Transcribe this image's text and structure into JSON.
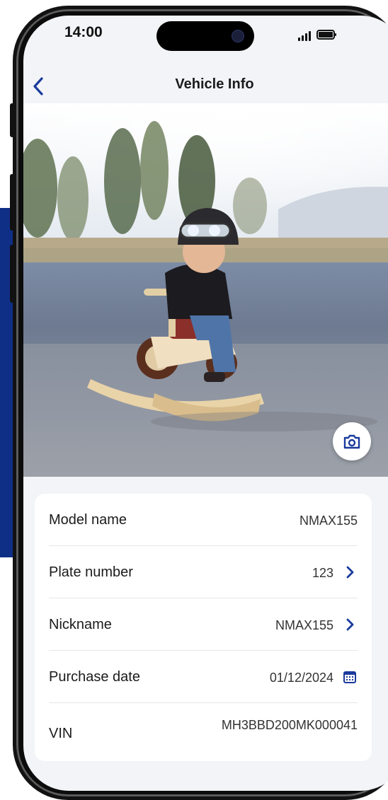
{
  "status_bar": {
    "time": "14:00"
  },
  "header": {
    "title": "Vehicle Info",
    "back_icon": "chevron-left-icon"
  },
  "hero": {
    "photo_description_icon": "child-on-rocking-motorbike-photo",
    "camera_icon": "camera-icon"
  },
  "vehicle_info": {
    "rows": [
      {
        "label": "Model name",
        "value": "NMAX155",
        "icon": ""
      },
      {
        "label": "Plate number",
        "value": "123",
        "icon": "chevron-right-icon"
      },
      {
        "label": "Nickname",
        "value": "NMAX155",
        "icon": "chevron-right-icon"
      },
      {
        "label": "Purchase date",
        "value": "01/12/2024",
        "icon": "calendar-icon"
      },
      {
        "label": "VIN",
        "value": "MH3BBD200MK000041",
        "icon": ""
      }
    ]
  },
  "colors": {
    "accent": "#1a3a9c",
    "side_panel": "#0f2f86",
    "screen_bg": "#f2f4f7",
    "card_bg": "#ffffff"
  }
}
